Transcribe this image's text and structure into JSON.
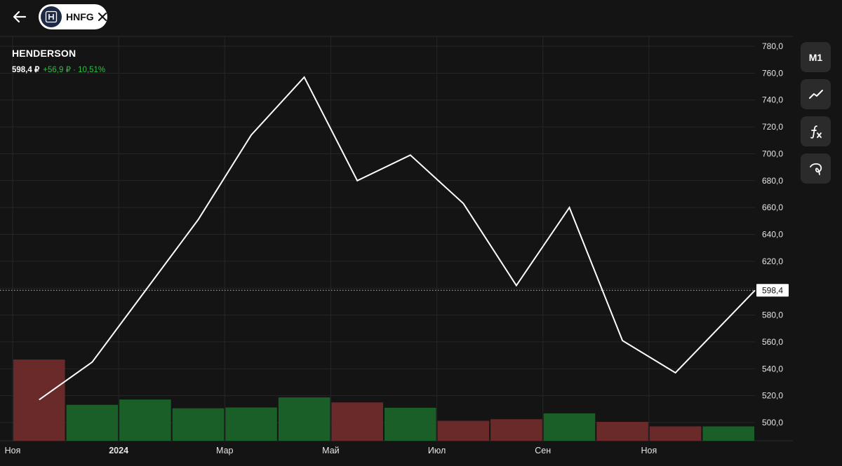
{
  "ticker": {
    "symbol": "HNFG",
    "logo_icon": "h-logo-icon"
  },
  "header": {
    "company": "HENDERSON",
    "price": "598,4 ₽",
    "change": "+56,9 ₽ · 10,51%"
  },
  "tools": [
    {
      "label": "M1",
      "name": "timeframe-button"
    },
    {
      "icon": "line-chart-icon",
      "name": "chart-type-button"
    },
    {
      "icon": "function-icon",
      "name": "indicators-button"
    },
    {
      "icon": "drawing-icon",
      "name": "drawing-tools-button"
    }
  ],
  "colors": {
    "background": "#141414",
    "up": "#1a5e28",
    "down": "#6b2a2a",
    "line": "#ffffff",
    "change_text": "#2fbf45"
  },
  "chart_data": {
    "type": "line",
    "title": "HENDERSON",
    "x": [
      "2023-11",
      "2023-12",
      "2024-01",
      "2024-02",
      "2024-03",
      "2024-04",
      "2024-05",
      "2024-06",
      "2024-07",
      "2024-08",
      "2024-09",
      "2024-10",
      "2024-11",
      "2024-12"
    ],
    "x_tick_labels": [
      "Ноя",
      "2024",
      "Мар",
      "Май",
      "Июл",
      "Сен",
      "Ноя"
    ],
    "x_tick_months": [
      "2023-11",
      "2024-01",
      "2024-03",
      "2024-05",
      "2024-07",
      "2024-09",
      "2024-11"
    ],
    "series": [
      {
        "type": "line",
        "values": [
          517,
          545,
          598,
          651,
          714,
          757,
          680,
          699,
          663,
          602,
          660,
          561,
          537,
          598.4
        ]
      }
    ],
    "volume": {
      "direction": [
        "down",
        "up",
        "up",
        "up",
        "up",
        "up",
        "down",
        "up",
        "down",
        "down",
        "up",
        "down",
        "down",
        "up"
      ],
      "relative": [
        0.305,
        0.135,
        0.155,
        0.122,
        0.125,
        0.163,
        0.144,
        0.124,
        0.075,
        0.081,
        0.103,
        0.071,
        0.054,
        0.054
      ]
    },
    "y_ticks": [
      "780,0",
      "760,0",
      "740,0",
      "720,0",
      "700,0",
      "680,0",
      "660,0",
      "640,0",
      "620,0",
      "600,0",
      "580,0",
      "560,0",
      "540,0",
      "520,0",
      "500,0"
    ],
    "y_tick_values": [
      780,
      760,
      740,
      720,
      700,
      680,
      660,
      640,
      620,
      600,
      580,
      560,
      540,
      520,
      500
    ],
    "ylim": [
      488,
      784
    ],
    "last_price_label": "598,4",
    "last_price": 598.4,
    "grid": true
  }
}
